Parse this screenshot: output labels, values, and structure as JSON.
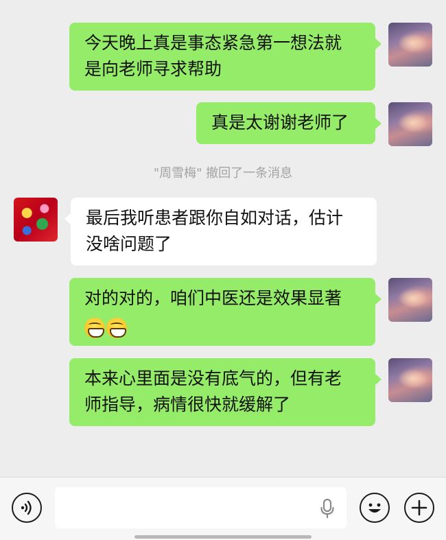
{
  "messages": [
    {
      "sender": "me",
      "lines": [
        "今天晚上真是事态紧急第一想法就",
        "是向老师寻求帮助"
      ]
    },
    {
      "sender": "me",
      "lines": [
        "真是太谢谢老师了"
      ]
    },
    {
      "sender": "other",
      "lines": [
        "最后我听患者跟你自如对话，估计",
        "没啥问题了"
      ]
    },
    {
      "sender": "me",
      "lines": [
        "对的对的，咱们中医还是效果显著"
      ],
      "emoji": [
        "grin-emoji",
        "grin-emoji"
      ]
    },
    {
      "sender": "me",
      "lines": [
        "本来心里面是没有底气的，但有老",
        "师指导，病情很快就缓解了"
      ]
    }
  ],
  "system": {
    "recall_notice": "\"周雪梅\" 撤回了一条消息"
  },
  "input_bar": {
    "input_value": "",
    "icons": [
      "voice-mode-icon",
      "microphone-icon",
      "emoji-icon",
      "plus-icon"
    ]
  },
  "colors": {
    "my_bubble": "#95ec69",
    "other_bubble": "#ffffff",
    "background": "#ededed"
  }
}
